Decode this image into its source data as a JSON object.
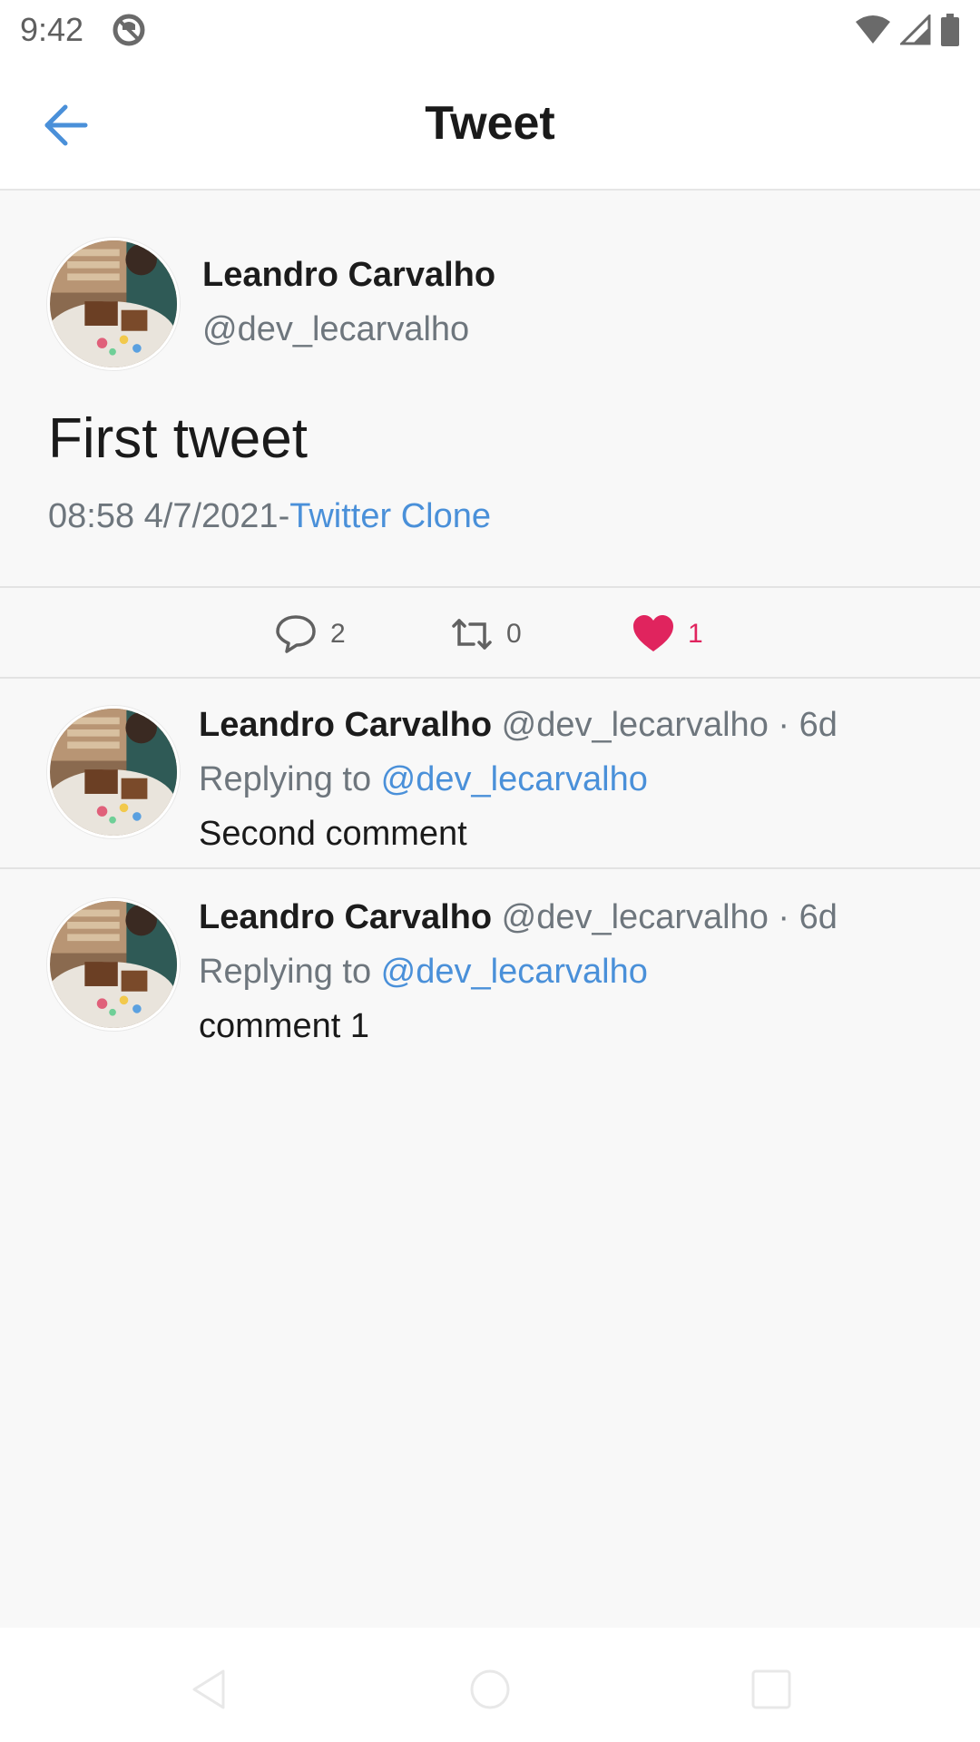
{
  "status_bar": {
    "time": "9:42",
    "icons": [
      "do-not-disturb-icon",
      "wifi-icon",
      "signal-icon",
      "battery-icon"
    ]
  },
  "app_bar": {
    "back_icon": "arrow-left-icon",
    "title": "Tweet"
  },
  "tweet": {
    "author_name": "Leandro Carvalho",
    "author_handle": "@dev_lecarvalho",
    "text": "First tweet",
    "timestamp": "08:58 4/7/2021",
    "separator": "-",
    "source": "Twitter Clone"
  },
  "actions": {
    "reply_count": "2",
    "retweet_count": "0",
    "like_count": "1"
  },
  "comments": [
    {
      "name": "Leandro Carvalho",
      "handle_time": "@dev_lecarvalho · 6d",
      "replying_prefix": "Replying to ",
      "replying_to": "@dev_lecarvalho",
      "text": "Second comment"
    },
    {
      "name": "Leandro Carvalho",
      "handle_time": "@dev_lecarvalho · 6d",
      "replying_prefix": "Replying to ",
      "replying_to": "@dev_lecarvalho",
      "text": "comment 1"
    }
  ],
  "colors": {
    "accent": "#4a90d9",
    "like": "#e0245e",
    "secondary_text": "#6e767d"
  }
}
